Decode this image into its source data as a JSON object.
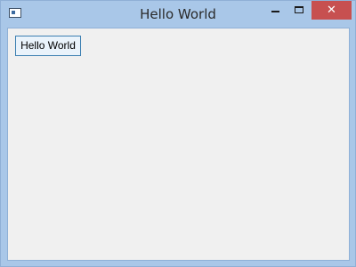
{
  "window": {
    "title": "Hello World",
    "controls": {
      "minimize_icon": "minimize-icon",
      "maximize_icon": "maximize-icon",
      "close_icon": "close-icon",
      "close_glyph": "✕"
    }
  },
  "content": {
    "button_label": "Hello World"
  },
  "colors": {
    "titlebar": "#a9c7e8",
    "close_button": "#c75050",
    "client_background": "#f0f0f0",
    "button_border": "#3c7fb1"
  }
}
